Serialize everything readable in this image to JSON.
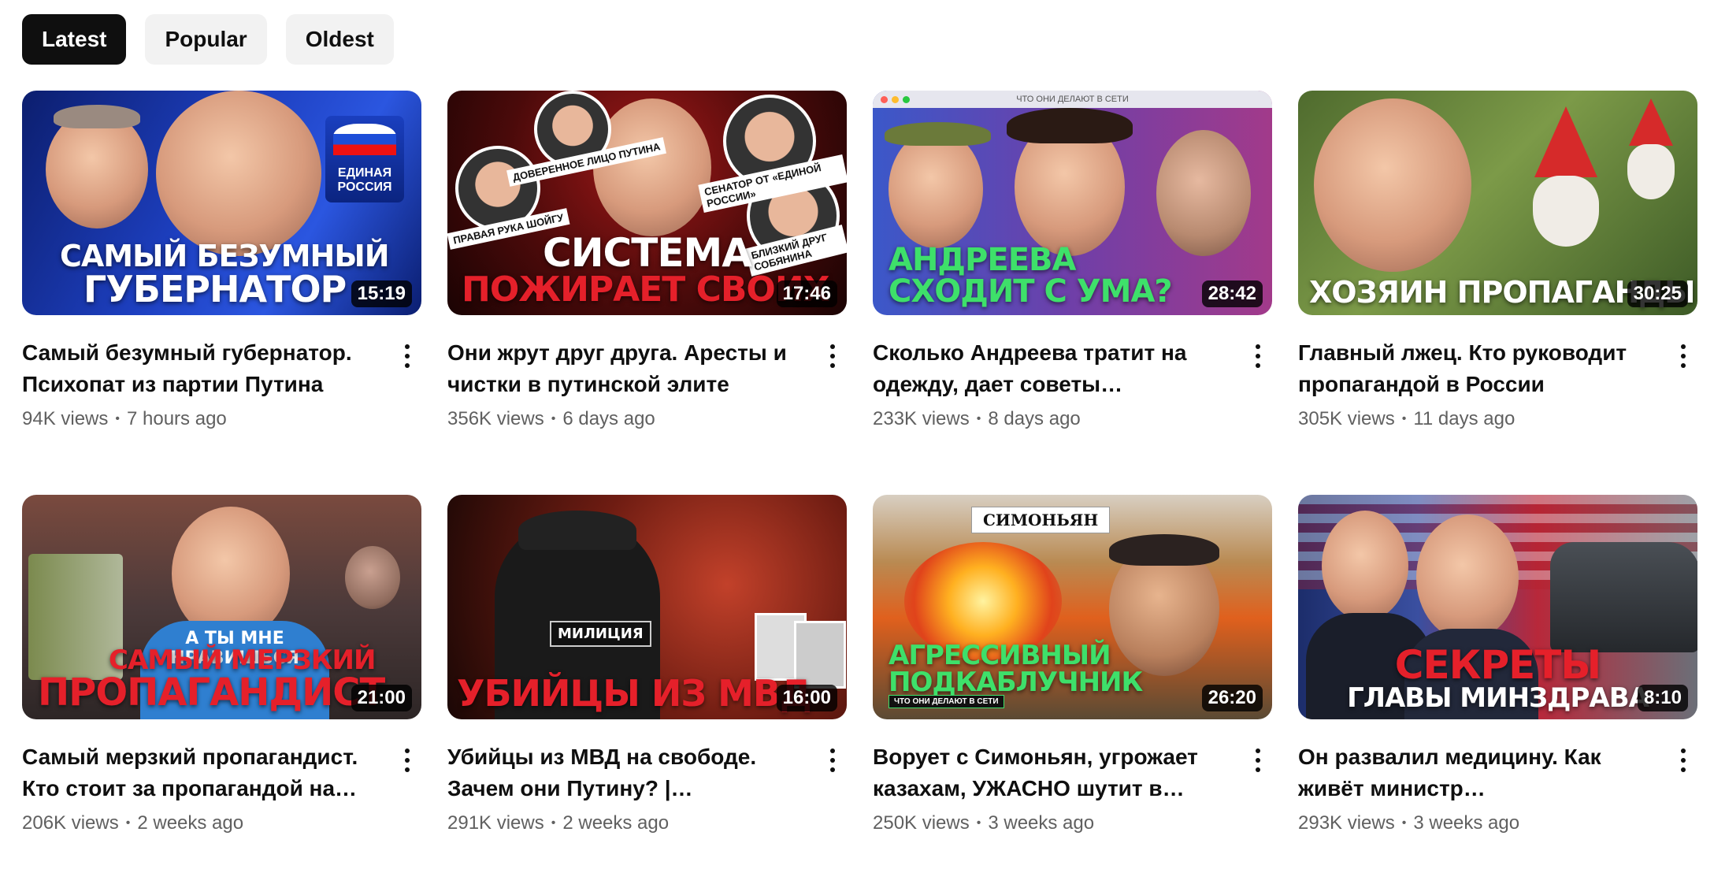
{
  "filters": {
    "chips": [
      {
        "label": "Latest",
        "active": true
      },
      {
        "label": "Popular",
        "active": false
      },
      {
        "label": "Oldest",
        "active": false
      }
    ]
  },
  "videos": [
    {
      "title": "Самый безумный губернатор. Психопат из партии Путина",
      "views": "94K views",
      "age": "7 hours ago",
      "duration": "15:19",
      "thumb_line1": "САМЫЙ БЕЗУМНЫЙ",
      "thumb_line2": "ГУБЕРНАТОР",
      "thumb_badge": "ЕДИНАЯ РОССИЯ"
    },
    {
      "title": "Они жрут друг друга. Аресты и чистки в путинской элите",
      "views": "356K views",
      "age": "6 days ago",
      "duration": "17:46",
      "thumb_line1": "СИСТЕМА",
      "thumb_line2": "ПОЖИРАЕТ СВОИХ",
      "thumb_tags": [
        "ДОВЕРЕННОЕ ЛИЦО ПУТИНА",
        "СЕНАТОР ОТ «ЕДИНОЙ РОССИИ»",
        "ПРАВАЯ РУКА ШОЙГУ",
        "БЛИЗКИЙ ДРУГ СОБЯНИНА"
      ]
    },
    {
      "title": "Сколько Андреева тратит на одежду, дает советы Михалкову…",
      "views": "233K views",
      "age": "8 days ago",
      "duration": "28:42",
      "thumb_line1": "АНДРЕЕВА",
      "thumb_line2": "СХОДИТ С УМА?",
      "thumb_topbar": "ЧТО ОНИ ДЕЛАЮТ В СЕТИ"
    },
    {
      "title": "Главный лжец. Кто руководит пропагандой в России",
      "views": "305K views",
      "age": "11 days ago",
      "duration": "30:25",
      "thumb_line1": "",
      "thumb_line2": "ХОЗЯИН ПРОПАГАНДЫ"
    },
    {
      "title": "Самый мерзкий пропагандист. Кто стоит за пропагандой на…",
      "views": "206K views",
      "age": "2 weeks ago",
      "duration": "21:00",
      "thumb_line1": "САМЫЙ МЕРЗКИЙ",
      "thumb_line2": "ПРОПАГАНДИСТ",
      "thumb_shirt": "А ТЫ МНЕ НРАВИШЬСЯ"
    },
    {
      "title": "Убийцы из МВД на свободе. Зачем они Путину? | Загадочное…",
      "views": "291K views",
      "age": "2 weeks ago",
      "duration": "16:00",
      "thumb_line1": "",
      "thumb_line2": "УБИЙЦЫ ИЗ МВД",
      "thumb_patch": "МИЛИЦИЯ"
    },
    {
      "title": "Ворует с Симоньян, угрожает казахам, УЖАСНО шутит в…",
      "views": "250K views",
      "age": "3 weeks ago",
      "duration": "26:20",
      "thumb_line1": "АГРЕССИВНЫЙ",
      "thumb_line2": "ПОДКАБЛУЧНИК",
      "thumb_nameplate": "СИМОНЬЯН",
      "thumb_small": "ЧТО ОНИ ДЕЛАЮТ В СЕТИ"
    },
    {
      "title": "Он развалил медицину. Как живёт министр здравоохранения",
      "views": "293K views",
      "age": "3 weeks ago",
      "duration": "8:10",
      "thumb_line1": "СЕКРЕТЫ",
      "thumb_line2": "ГЛАВЫ МИНЗДРАВА"
    }
  ],
  "colors": {
    "chip_active_bg": "#0f0f0f",
    "chip_bg": "#f2f2f2",
    "meta_text": "#606060",
    "headline_red": "#e5202a",
    "headline_green": "#3ee06a"
  },
  "icons": [
    "more-vert-icon"
  ]
}
